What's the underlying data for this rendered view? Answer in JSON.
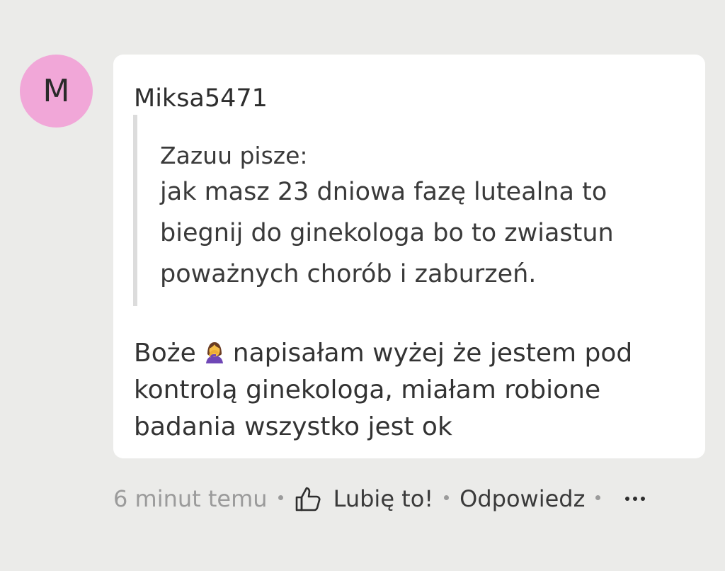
{
  "comment": {
    "avatar_letter": "M",
    "avatar_color": "#f1a7d8",
    "author": "Miksa5471",
    "quote": {
      "author_line": "Zazuu pisze:",
      "text": "jak masz 23 dniowa fazę lutealna to biegnij do ginekologa bo to zwiastun poważnych chorób i zaburzeń."
    },
    "body": {
      "before_emoji": "Boże",
      "emoji": "woman-facepalming",
      "after_emoji": "napisałam wyżej że jestem pod kontrolą ginekologa, miałam robione badania wszystko jest ok"
    }
  },
  "footer": {
    "time": "6 minut temu",
    "like_icon": "thumbs-up-icon",
    "like_label": "Lubię to!",
    "reply_label": "Odpowiedz",
    "more_icon": "more-dots-icon"
  }
}
